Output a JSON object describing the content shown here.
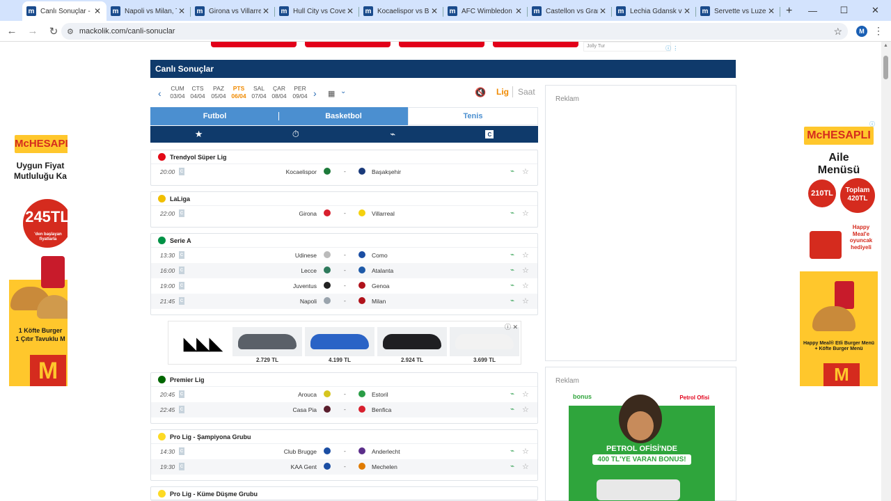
{
  "browser": {
    "tabs": [
      {
        "label": "Canlı Sonuçlar - İdd",
        "active": true
      },
      {
        "label": "Napoli vs Milan, Tah",
        "active": false
      },
      {
        "label": "Girona vs Villarreal",
        "active": false
      },
      {
        "label": "Hull City vs Covent",
        "active": false
      },
      {
        "label": "Kocaelispor vs Başa",
        "active": false
      },
      {
        "label": "AFC Wimbledon vs",
        "active": false
      },
      {
        "label": "Castellon vs Granac",
        "active": false
      },
      {
        "label": "Lechia Gdansk vs K",
        "active": false
      },
      {
        "label": "Servette vs Luzern",
        "active": false
      }
    ],
    "favicon_letter": "m",
    "url": "mackolik.com/canli-sonuclar",
    "profile_initial": "M"
  },
  "top_ad": {
    "jolly_label": "Jolly Tur"
  },
  "page": {
    "title": "Canlı Sonuçlar",
    "days": [
      {
        "name": "CUM",
        "date": "03/04",
        "current": false
      },
      {
        "name": "CTS",
        "date": "04/04",
        "current": false
      },
      {
        "name": "PAZ",
        "date": "05/04",
        "current": false
      },
      {
        "name": "PTS",
        "date": "06/04",
        "current": true
      },
      {
        "name": "SAL",
        "date": "07/04",
        "current": false
      },
      {
        "name": "ÇAR",
        "date": "08/04",
        "current": false
      },
      {
        "name": "PER",
        "date": "09/04",
        "current": false
      }
    ],
    "sort_lig": "Lig",
    "sort_saat": "Saat",
    "sport_tabs": [
      "Futbol",
      "Basketbol",
      "Tenis"
    ],
    "active_sport": "Tenis",
    "icon_bar": [
      "star-icon",
      "stopwatch-icon",
      "tv-icon",
      "c-badge-icon"
    ],
    "c_badge": "C"
  },
  "leagues": [
    {
      "name": "Trendyol Süper Lig",
      "flag_color": "#e30a17",
      "matches": [
        {
          "time": "20:00",
          "home": "Kocaelispor",
          "away": "Başakşehir",
          "home_color": "#1d7a3a",
          "away_color": "#1a3a7a"
        }
      ]
    },
    {
      "name": "LaLiga",
      "flag_color": "#f1bf00",
      "matches": [
        {
          "time": "22:00",
          "home": "Girona",
          "away": "Villarreal",
          "home_color": "#d8202e",
          "away_color": "#f5d10e"
        }
      ]
    },
    {
      "name": "Serie A",
      "flag_color": "#009246",
      "matches": [
        {
          "time": "13:30",
          "home": "Udinese",
          "away": "Como",
          "home_color": "#bbbbbb",
          "away_color": "#1b4ea3"
        },
        {
          "time": "16:00",
          "home": "Lecce",
          "away": "Atalanta",
          "home_color": "#2e7a5c",
          "away_color": "#1e5aa8"
        },
        {
          "time": "19:00",
          "home": "Juventus",
          "away": "Genoa",
          "home_color": "#222222",
          "away_color": "#b0121b"
        },
        {
          "time": "21:45",
          "home": "Napoli",
          "away": "Milan",
          "home_color": "#9aa4ad",
          "away_color": "#b0121b"
        }
      ]
    },
    {
      "name": "Premier Lig",
      "flag_color": "#006600",
      "matches": [
        {
          "time": "20:45",
          "home": "Arouca",
          "away": "Estoril",
          "home_color": "#d6c51f",
          "away_color": "#2a9d46"
        },
        {
          "time": "22:45",
          "home": "Casa Pia",
          "away": "Benfica",
          "home_color": "#5a1e2d",
          "away_color": "#d8202e"
        }
      ]
    },
    {
      "name": "Pro Lig - Şampiyona Grubu",
      "flag_color": "#fdda24",
      "matches": [
        {
          "time": "14:30",
          "home": "Club Brugge",
          "away": "Anderlecht",
          "home_color": "#1b4ea3",
          "away_color": "#5b2e8a"
        },
        {
          "time": "19:30",
          "home": "KAA Gent",
          "away": "Mechelen",
          "home_color": "#1b4ea3",
          "away_color": "#e07b00"
        }
      ]
    },
    {
      "name": "Pro Lig - Küme Düşme Grubu",
      "flag_color": "#fdda24",
      "matches": []
    }
  ],
  "adidas_ad": {
    "prices": [
      "2.729 TL",
      "4.199 TL",
      "2.924 TL",
      "3.699 TL"
    ],
    "shoe_colors": [
      "#5a6068",
      "#2a63c6",
      "#1f1f22",
      "#f2f2f2"
    ]
  },
  "right_column": {
    "reklam_label": "Reklam"
  },
  "petrol_ad": {
    "brand_tag": "bonus",
    "company": "Petrol Ofisi",
    "headline": "PETROL OFİSİ'NDE",
    "offer": "400 TL'YE VARAN BONUS!"
  },
  "left_ad": {
    "brand": "McHESAPLI",
    "line1": "Uygun Fiyat",
    "line2": "Mutluluğu Ka",
    "price": "245TL",
    "price_note": "'den başlayan fiyatlarla",
    "bottom1": "1 Köfte Burger",
    "bottom2": "1 Çıtır Tavuklu M",
    "logo": "M"
  },
  "right_ad": {
    "brand": "McHESAPLI",
    "line1": "Aile",
    "line2": "Menüsü",
    "price1": "210TL",
    "price2": "Toplam 420TL",
    "promo": "Happy Meal'e oyuncak hediyeli",
    "bottom": "Happy Meal® Etli Burger Menü + Köfte Burger Menü",
    "logo": "M"
  }
}
